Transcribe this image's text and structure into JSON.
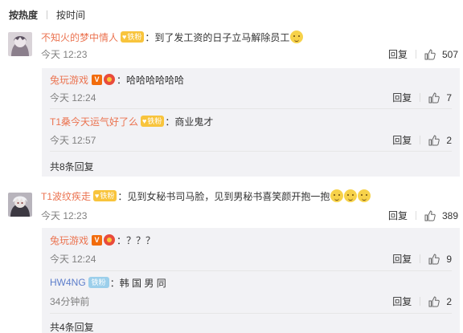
{
  "sort": {
    "hot_label": "按热度",
    "time_label": "按时间"
  },
  "comments": [
    {
      "user": "不知火的梦中情人",
      "fan_badge": "铁粉",
      "text": "：到了发工资的日子立马解除员工",
      "emoji_count": 1,
      "time": "今天 12:23",
      "reply_label": "回复",
      "likes": "507",
      "replies": [
        {
          "user": "兔玩游戏",
          "text": "：哈哈哈哈哈哈",
          "time": "今天 12:24",
          "reply_label": "回复",
          "likes": "7"
        },
        {
          "user": "T1桑今天运气好了么",
          "fan_badge": "铁粉",
          "text": "：商业鬼才",
          "time": "今天 12:57",
          "reply_label": "回复",
          "likes": "2"
        }
      ],
      "more": "共8条回复"
    },
    {
      "user": "T1波纹疾走",
      "fan_badge": "铁粉",
      "text": "：见到女秘书司马脸，见到男秘书喜笑颜开抱一抱",
      "emoji_count": 3,
      "time": "今天 12:23",
      "reply_label": "回复",
      "likes": "389",
      "replies": [
        {
          "user": "兔玩游戏",
          "text": "：？？？",
          "time": "今天 12:24",
          "reply_label": "回复",
          "likes": "9"
        },
        {
          "user": "HW4NG",
          "iron_badge": "铁粉",
          "text": "：韩 国 男 同",
          "time": "34分钟前",
          "reply_label": "回复",
          "likes": "2"
        }
      ],
      "more": "共4条回复"
    }
  ],
  "colors": {
    "username": "#eb7350",
    "reply_bg": "#f2f2f5",
    "time": "#808080",
    "fan_badge": "#f8c43c",
    "iron_badge": "#9ccfeb",
    "verified": "#f26c0c"
  }
}
